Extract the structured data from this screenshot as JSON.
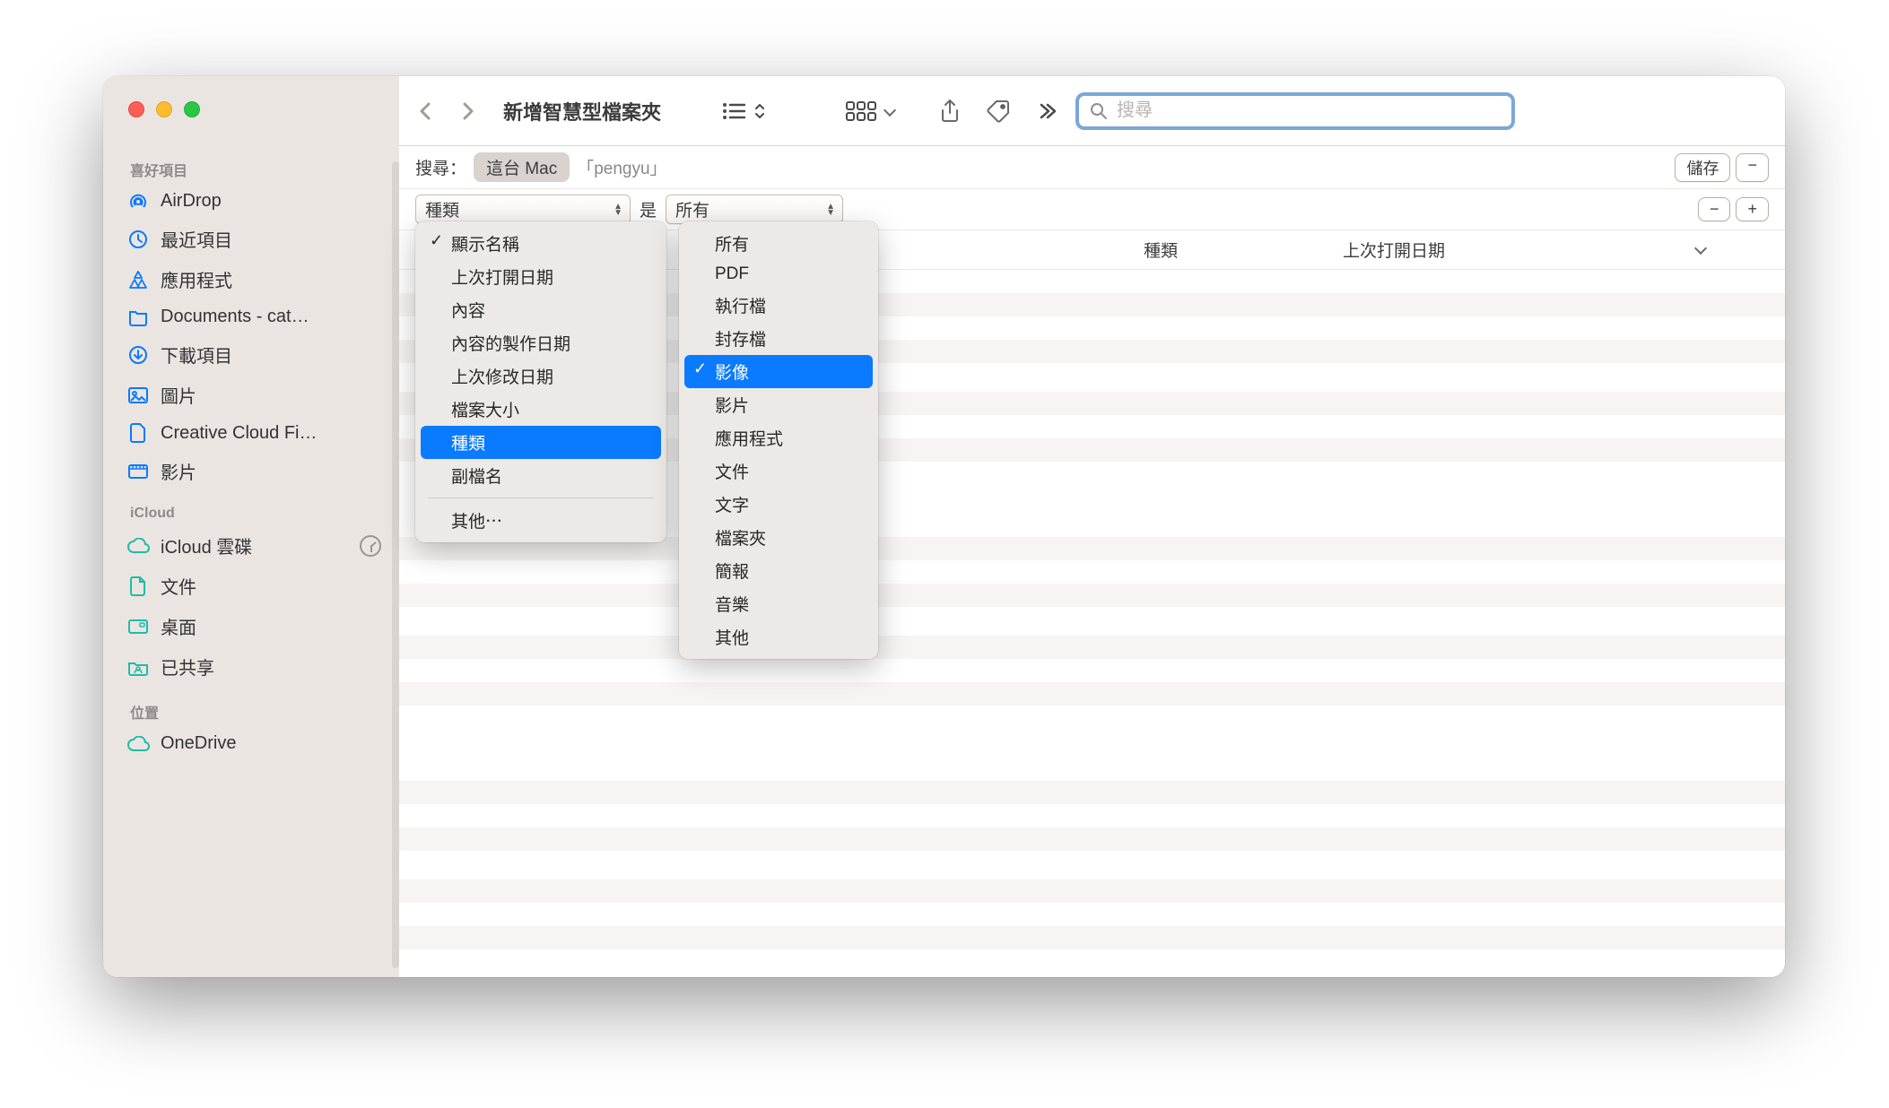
{
  "window": {
    "title": "新增智慧型檔案夾"
  },
  "search": {
    "placeholder": "搜尋"
  },
  "sidebar": {
    "sections": [
      {
        "title": "喜好項目",
        "items": [
          {
            "label": "AirDrop",
            "icon": "airdrop"
          },
          {
            "label": "最近項目",
            "icon": "clock"
          },
          {
            "label": "應用程式",
            "icon": "apps"
          },
          {
            "label": "Documents - cat…",
            "icon": "folder"
          },
          {
            "label": "下載項目",
            "icon": "download"
          },
          {
            "label": "圖片",
            "icon": "photo"
          },
          {
            "label": "Creative Cloud Fi…",
            "icon": "file"
          },
          {
            "label": "影片",
            "icon": "video"
          }
        ]
      },
      {
        "title": "iCloud",
        "items": [
          {
            "label": "iCloud 雲碟",
            "icon": "cloud",
            "trail": true
          },
          {
            "label": "文件",
            "icon": "doc"
          },
          {
            "label": "桌面",
            "icon": "desktop"
          },
          {
            "label": "已共享",
            "icon": "shared"
          }
        ]
      },
      {
        "title": "位置",
        "items": [
          {
            "label": "OneDrive",
            "icon": "onedrive"
          }
        ]
      }
    ]
  },
  "scope": {
    "label": "搜尋：",
    "activeOption": "這台 Mac",
    "otherOption": "「pengyu」",
    "save": "儲存",
    "minus": "−"
  },
  "criteria": {
    "kind_display": "種類",
    "connector": "是",
    "type_display": "所有",
    "minus": "−",
    "plus": "+"
  },
  "columns": {
    "kind": "種類",
    "date": "上次打開日期"
  },
  "kind_menu": {
    "items": [
      {
        "label": "顯示名稱",
        "checked": true
      },
      {
        "label": "上次打開日期"
      },
      {
        "label": "內容"
      },
      {
        "label": "內容的製作日期"
      },
      {
        "label": "上次修改日期"
      },
      {
        "label": "檔案大小"
      },
      {
        "label": "種類",
        "selected": true
      },
      {
        "label": "副檔名"
      }
    ],
    "other": "其他⋯"
  },
  "type_menu": {
    "items": [
      {
        "label": "所有"
      },
      {
        "label": "PDF"
      },
      {
        "label": "執行檔"
      },
      {
        "label": "封存檔"
      },
      {
        "label": "影像",
        "selected": true,
        "checked": true
      },
      {
        "label": "影片"
      },
      {
        "label": "應用程式"
      },
      {
        "label": "文件"
      },
      {
        "label": "文字"
      },
      {
        "label": "檔案夾"
      },
      {
        "label": "簡報"
      },
      {
        "label": "音樂"
      },
      {
        "label": "其他"
      }
    ]
  }
}
